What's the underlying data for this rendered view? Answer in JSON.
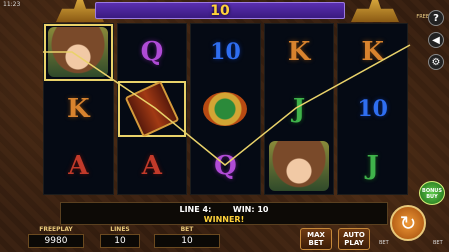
{
  "status": {
    "time": "11:23"
  },
  "header": {
    "win_display": "10",
    "freeplay_tag": "FREEPLAY"
  },
  "reels": [
    [
      "woman",
      "K",
      "A"
    ],
    [
      "Q",
      "book",
      "A"
    ],
    [
      "10",
      "mask",
      "Q"
    ],
    [
      "K",
      "J",
      "woman"
    ],
    [
      "K",
      "10",
      "J"
    ]
  ],
  "side_buttons": {
    "help": "?",
    "sound": "◀",
    "settings": "⚙"
  },
  "message": {
    "line_label": "LINE 4:",
    "win_label": "WIN: 10",
    "status": "WINNER!"
  },
  "stats": [
    {
      "label": "FREEPLAY",
      "value": "9980"
    },
    {
      "label": "LINES",
      "value": "10"
    },
    {
      "label": "BET",
      "value": "10"
    }
  ],
  "controls": {
    "max_bet": "MAX BET",
    "auto_play": "AUTO PLAY",
    "bonus_buy": "BONUS BUY",
    "bet_minus": "BET",
    "bet_plus": "BET",
    "spin": "↻"
  },
  "colors": {
    "win_yellow": "#ffd23a",
    "banner_purple": "#5a2fb0",
    "spin_orange": "#f09a38"
  }
}
